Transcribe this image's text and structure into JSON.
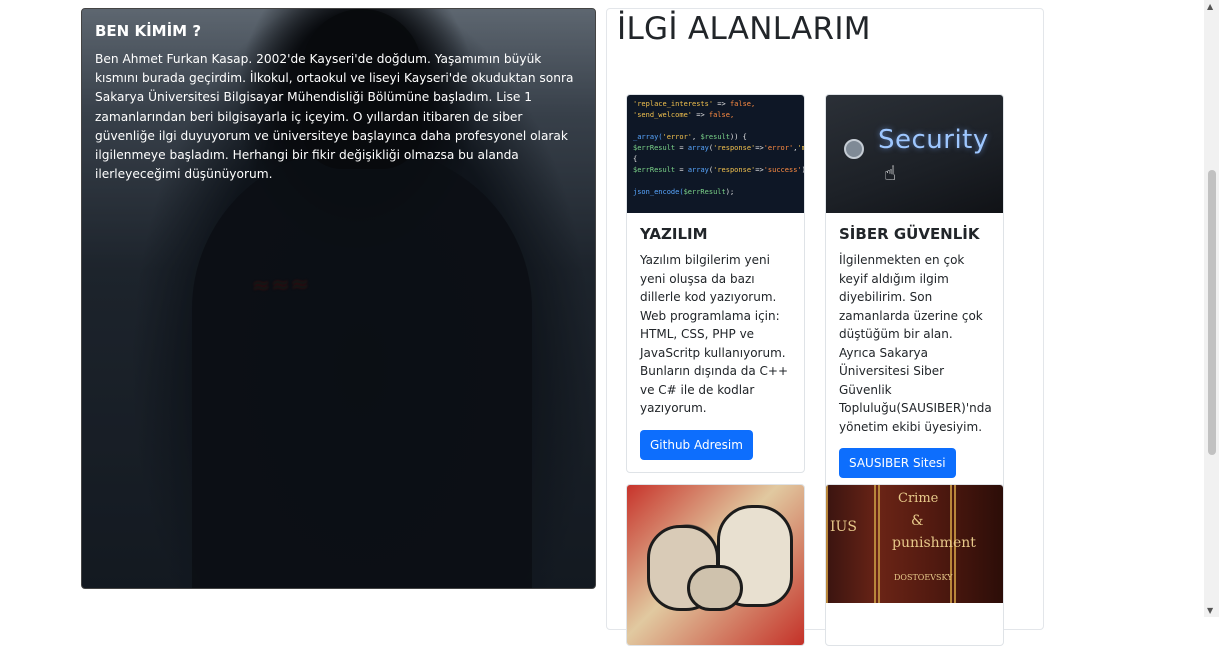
{
  "about": {
    "title": "BEN KİMİM ?",
    "text": "Ben Ahmet Furkan Kasap. 2002'de Kayseri'de doğdum. Yaşamımın büyük kısmını burada geçirdim. İlkokul, ortaokul ve liseyi Kayseri'de okuduktan sonra Sakarya Üniversitesi Bilgisayar Mühendisliği Bölümüne başladım. Lise 1 zamanlarından beri bilgisayarla iç içeyim. O yıllardan itibaren de siber güvenliğe ilgi duyuyorum ve üniversiteye başlayınca daha profesyonel olarak ilgilenmeye başladım. Herhangi bir fikir değişikliği olmazsa bu alanda ilerleyeceğimi düşünüyorum."
  },
  "interests": {
    "heading": "İLGİ ALANLARIM",
    "cards": [
      {
        "title": "YAZILIM",
        "text": "Yazılım bilgilerim yeni yeni oluşsa da bazı dillerle kod yazıyorum. Web programlama için: HTML, CSS, PHP ve JavaScritp kullanıyorum. Bunların dışında da C++ ve C# ile de kodlar yazıyorum.",
        "button": "Github Adresim"
      },
      {
        "title": "SİBER GÜVENLİK",
        "text": "İlgilenmekten en çok keyif aldığım ilgim diyebilirim. Son zamanlarda üzerine çok düştüğüm bir alan. Ayrıca Sakarya Üniversitesi Siber Güvenlik Topluluğu(SAUSIBER)'nda yönetim ekibi üyesiyim.",
        "button": "SAUSIBER Sitesi"
      }
    ],
    "images": {
      "security_word": "Security",
      "book_titles": [
        "Crime",
        "&",
        "punishment",
        "DOSTOEVSKY",
        "IUS"
      ]
    }
  },
  "colors": {
    "primary": "#0d6efd",
    "heading": "#212529"
  }
}
